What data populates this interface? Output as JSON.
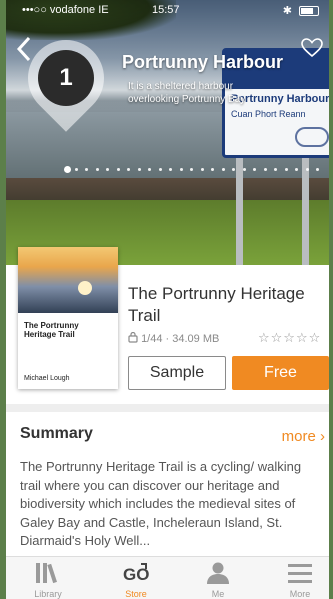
{
  "status": {
    "carrier": "•••○○ vodafone IE",
    "time": "15:57",
    "bt": "✱"
  },
  "hero": {
    "stop_number": "1",
    "title": "Portrunny Harbour",
    "subtitle": "It is a sheltered harbour overlooking Portrunny Bay",
    "sign_title": "Portrunny Harbour",
    "sign_subtitle": "Cuan Phort Reann",
    "back_icon": "back-chevron-icon",
    "favorite_icon": "heart-icon",
    "carousel": {
      "total": 25,
      "active": 0
    }
  },
  "trail": {
    "title": "The Portrunny Heritage Trail",
    "meta": "1/44 · 34.09 MB",
    "rating_stars": "☆☆☆☆☆",
    "cover_title": "The Portrunny Heritage Trail",
    "cover_author": "Michael Lough",
    "sample_label": "Sample",
    "free_label": "Free"
  },
  "summary": {
    "heading": "Summary",
    "more_label": "more ›",
    "text": "The Portrunny Heritage Trail is a cycling/ walking trail where you can discover our heritage and biodiversity which includes the medieval sites of Galey Bay and Castle, Incheleraun Island, St. Diarmaid's Holy Well..."
  },
  "tabs": [
    {
      "label": "Library",
      "icon": "library-icon",
      "active": false
    },
    {
      "label": "Store",
      "icon": "go-store-icon",
      "active": true
    },
    {
      "label": "Me",
      "icon": "person-icon",
      "active": false
    },
    {
      "label": "More",
      "icon": "menu-icon",
      "active": false
    }
  ],
  "colors": {
    "accent": "#f08a22",
    "sign_blue": "#1c3b7a"
  }
}
